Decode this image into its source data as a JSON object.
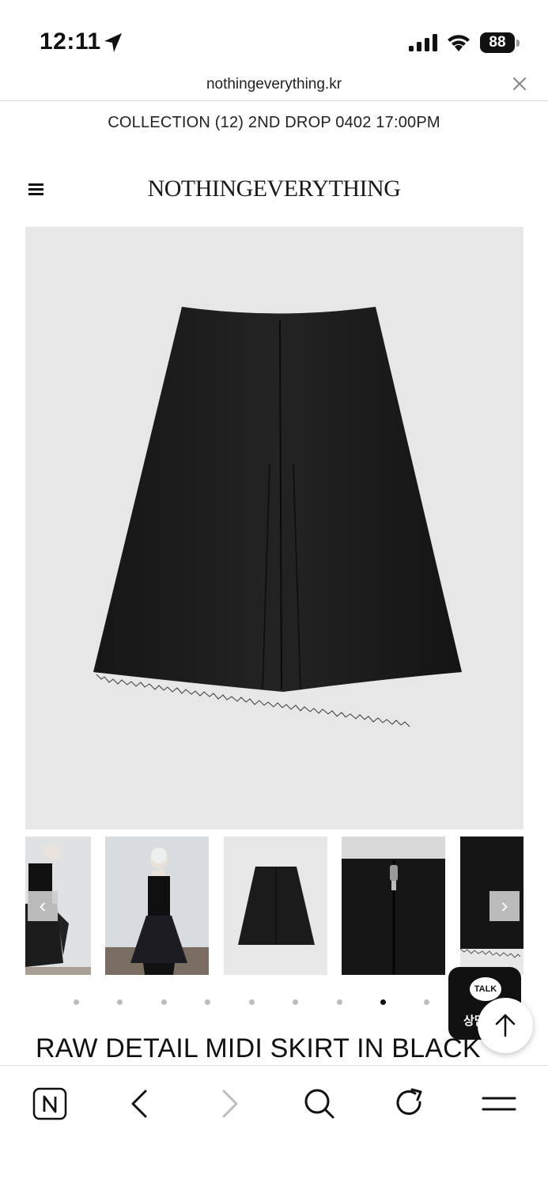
{
  "status_bar": {
    "time": "12:11",
    "battery": "88",
    "icons": [
      "location-arrow-icon",
      "cellular-signal-icon",
      "wifi-icon",
      "battery-icon"
    ]
  },
  "browser": {
    "url": "nothingeverything.kr",
    "close_icon": "close-icon"
  },
  "announcement": "COLLECTION (12) 2ND DROP 0402 17:00PM",
  "header": {
    "logo": "NOTHINGEVERYTHING",
    "menu_icon": "hamburger-icon"
  },
  "gallery": {
    "thumbnails": [
      "model-side-view",
      "model-full-view",
      "skirt-flat-view",
      "zipper-detail",
      "hem-detail"
    ],
    "dots_count": 10,
    "active_dot_index": 7,
    "prev_arrow": "‹",
    "next_arrow": "›"
  },
  "product": {
    "title": "RAW DETAIL MIDI SKIRT IN BLACK"
  },
  "floating": {
    "talk_badge": "TALK",
    "talk_label": "상담",
    "scroll_top_icon": "arrow-up-icon"
  },
  "toolbar": {
    "icons": [
      "naver-home-icon",
      "back-icon",
      "forward-icon",
      "search-icon",
      "refresh-icon",
      "menu-icon"
    ]
  },
  "colors": {
    "background": "#ffffff",
    "image_background": "#e6e7e6",
    "text": "#111111",
    "active_dot": "#111111",
    "inactive_dot": "#bdbdbd"
  }
}
